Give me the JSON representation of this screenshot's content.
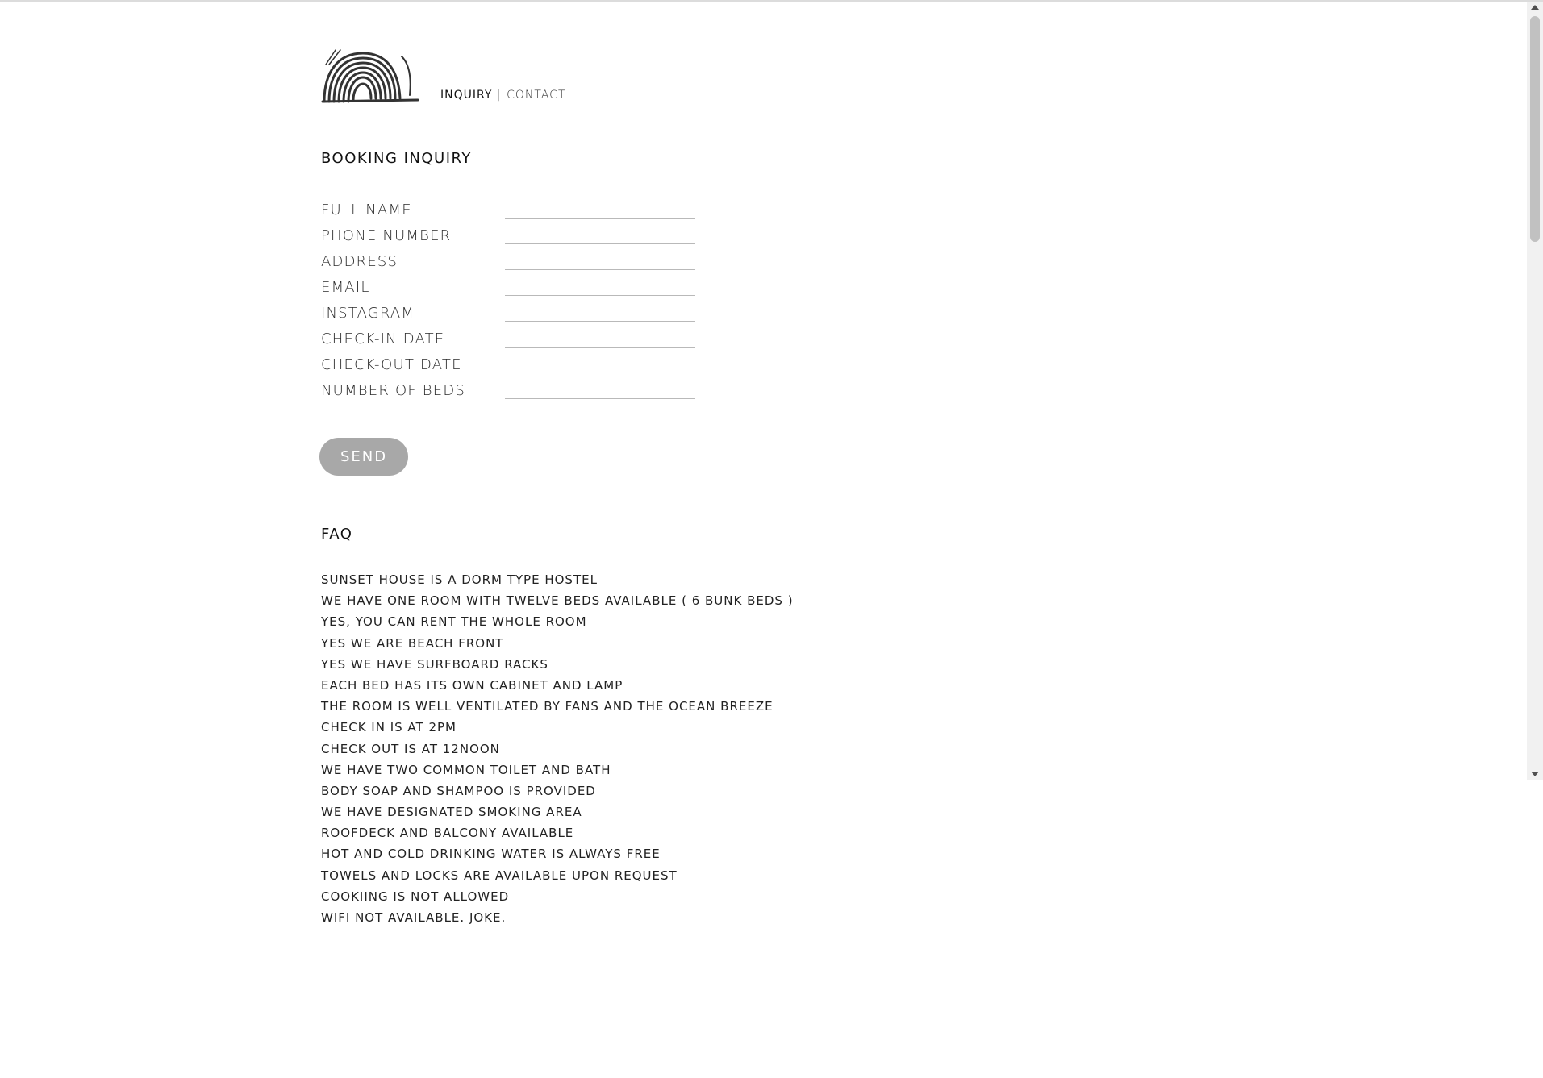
{
  "nav": {
    "inquiry": "INQUIRY",
    "separator": "|",
    "contact": "CONTACT"
  },
  "logo": {
    "icon": "sunset-arch-logo"
  },
  "booking": {
    "title": "BOOKING INQUIRY",
    "fields": [
      {
        "label": "FULL NAME",
        "value": ""
      },
      {
        "label": "PHONE NUMBER",
        "value": ""
      },
      {
        "label": "ADDRESS",
        "value": ""
      },
      {
        "label": "EMAIL",
        "value": ""
      },
      {
        "label": "INSTAGRAM",
        "value": ""
      },
      {
        "label": "CHECK-IN DATE",
        "value": ""
      },
      {
        "label": "CHECK-OUT DATE",
        "value": ""
      },
      {
        "label": "NUMBER OF BEDS",
        "value": ""
      }
    ],
    "send_label": "SEND"
  },
  "faq": {
    "title": "FAQ",
    "items": [
      "SUNSET HOUSE IS A DORM TYPE HOSTEL",
      "WE HAVE ONE ROOM WITH TWELVE BEDS AVAILABLE ( 6 BUNK BEDS )",
      "YES, YOU CAN RENT THE WHOLE ROOM",
      "YES WE ARE BEACH FRONT",
      "YES WE HAVE SURFBOARD RACKS",
      "EACH BED HAS ITS OWN CABINET AND LAMP",
      "THE ROOM IS WELL VENTILATED BY FANS AND THE OCEAN BREEZE",
      "CHECK IN IS AT 2PM",
      "CHECK OUT IS AT 12NOON",
      "WE HAVE TWO COMMON TOILET AND BATH",
      "BODY SOAP AND SHAMPOO IS PROVIDED",
      "WE HAVE DESIGNATED SMOKING AREA",
      "ROOFDECK AND BALCONY AVAILABLE",
      "HOT AND COLD DRINKING WATER IS ALWAYS FREE",
      "TOWELS AND LOCKS ARE AVAILABLE UPON REQUEST",
      "COOKIING IS NOT ALLOWED",
      "WIFI NOT AVAILABLE. JOKE."
    ]
  },
  "colors": {
    "button_bg": "#a8a8a8",
    "text": "#1e1e1e",
    "field_underline": "#b9b9b9"
  }
}
